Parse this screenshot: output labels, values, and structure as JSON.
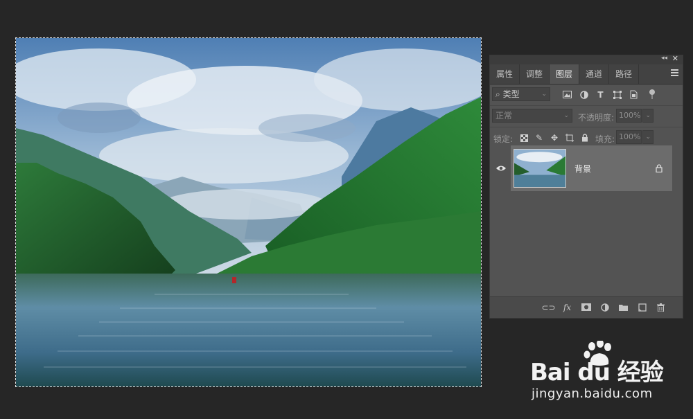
{
  "panel": {
    "tabs": [
      {
        "label": "属性",
        "active": false
      },
      {
        "label": "调整",
        "active": false
      },
      {
        "label": "图层",
        "active": true
      },
      {
        "label": "通道",
        "active": false
      },
      {
        "label": "路径",
        "active": false
      }
    ],
    "filter": {
      "value": "类型"
    },
    "blend": {
      "mode": "正常",
      "opacity_label": "不透明度:",
      "opacity_value": "100%"
    },
    "lock": {
      "label": "锁定:",
      "fill_label": "填充:",
      "fill_value": "100%"
    },
    "layers": [
      {
        "name": "背景",
        "visible": true,
        "locked": true
      }
    ]
  },
  "watermark": {
    "logo_text": "Bai du 经验",
    "url": "jingyan.baidu.com"
  },
  "colors": {
    "app_bg": "#262626",
    "panel_bg": "#535353",
    "selected_layer": "#6c6c6c"
  }
}
